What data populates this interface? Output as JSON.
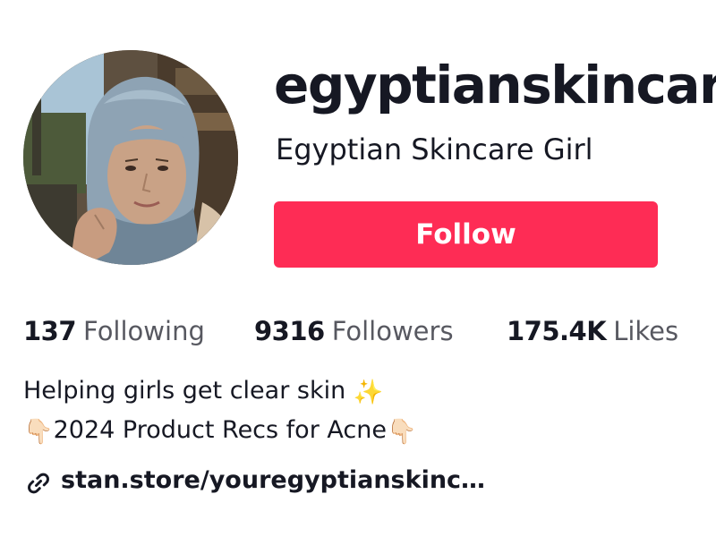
{
  "profile": {
    "username": "egyptianskincare",
    "display_name": "Egyptian Skincare Girl",
    "follow_label": "Follow",
    "colors": {
      "follow_button": "#fe2c55",
      "text_primary": "#161823",
      "text_secondary": "#6b6d75"
    }
  },
  "stats": {
    "following": {
      "value": "137",
      "label": "Following"
    },
    "followers": {
      "value": "9316",
      "label": "Followers"
    },
    "likes": {
      "value": "175.4K",
      "label": "Likes"
    }
  },
  "bio": {
    "line1": "Helping girls get clear skin",
    "line1_emoji": "✨",
    "line2_lead_emoji": "👇🏻",
    "line2": "2024 Product Recs for Acne",
    "line2_trail_emoji": "👇🏻"
  },
  "link": {
    "text": "stan.store/youregyptianskinc…",
    "icon": "link-icon"
  },
  "avatar": {
    "icon": "profile-photo"
  }
}
